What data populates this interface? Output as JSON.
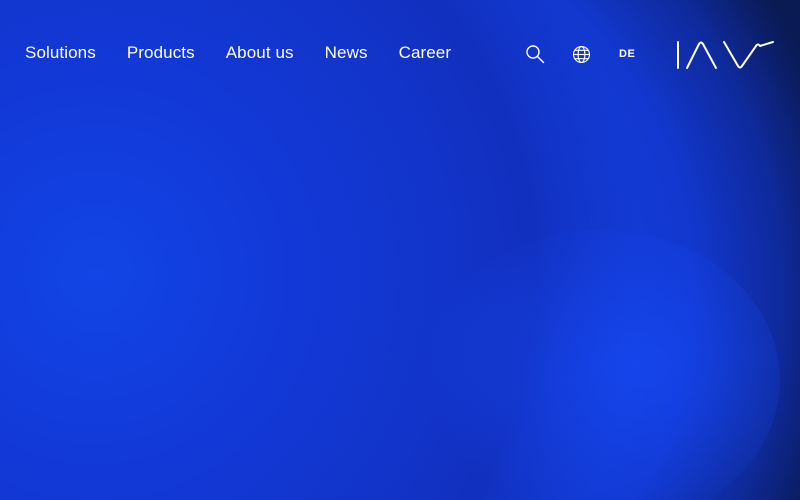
{
  "nav": {
    "items": [
      {
        "label": "Solutions"
      },
      {
        "label": "Products"
      },
      {
        "label": "About us"
      },
      {
        "label": "News"
      },
      {
        "label": "Career"
      }
    ]
  },
  "tools": {
    "search_icon": "search-icon",
    "globe_icon": "globe-icon",
    "language_label": "DE"
  },
  "brand": {
    "logo_text": "IAV"
  },
  "colors": {
    "background_dark": "#0a1a52",
    "orb_blue": "#1340e0",
    "text": "#ffffff"
  }
}
